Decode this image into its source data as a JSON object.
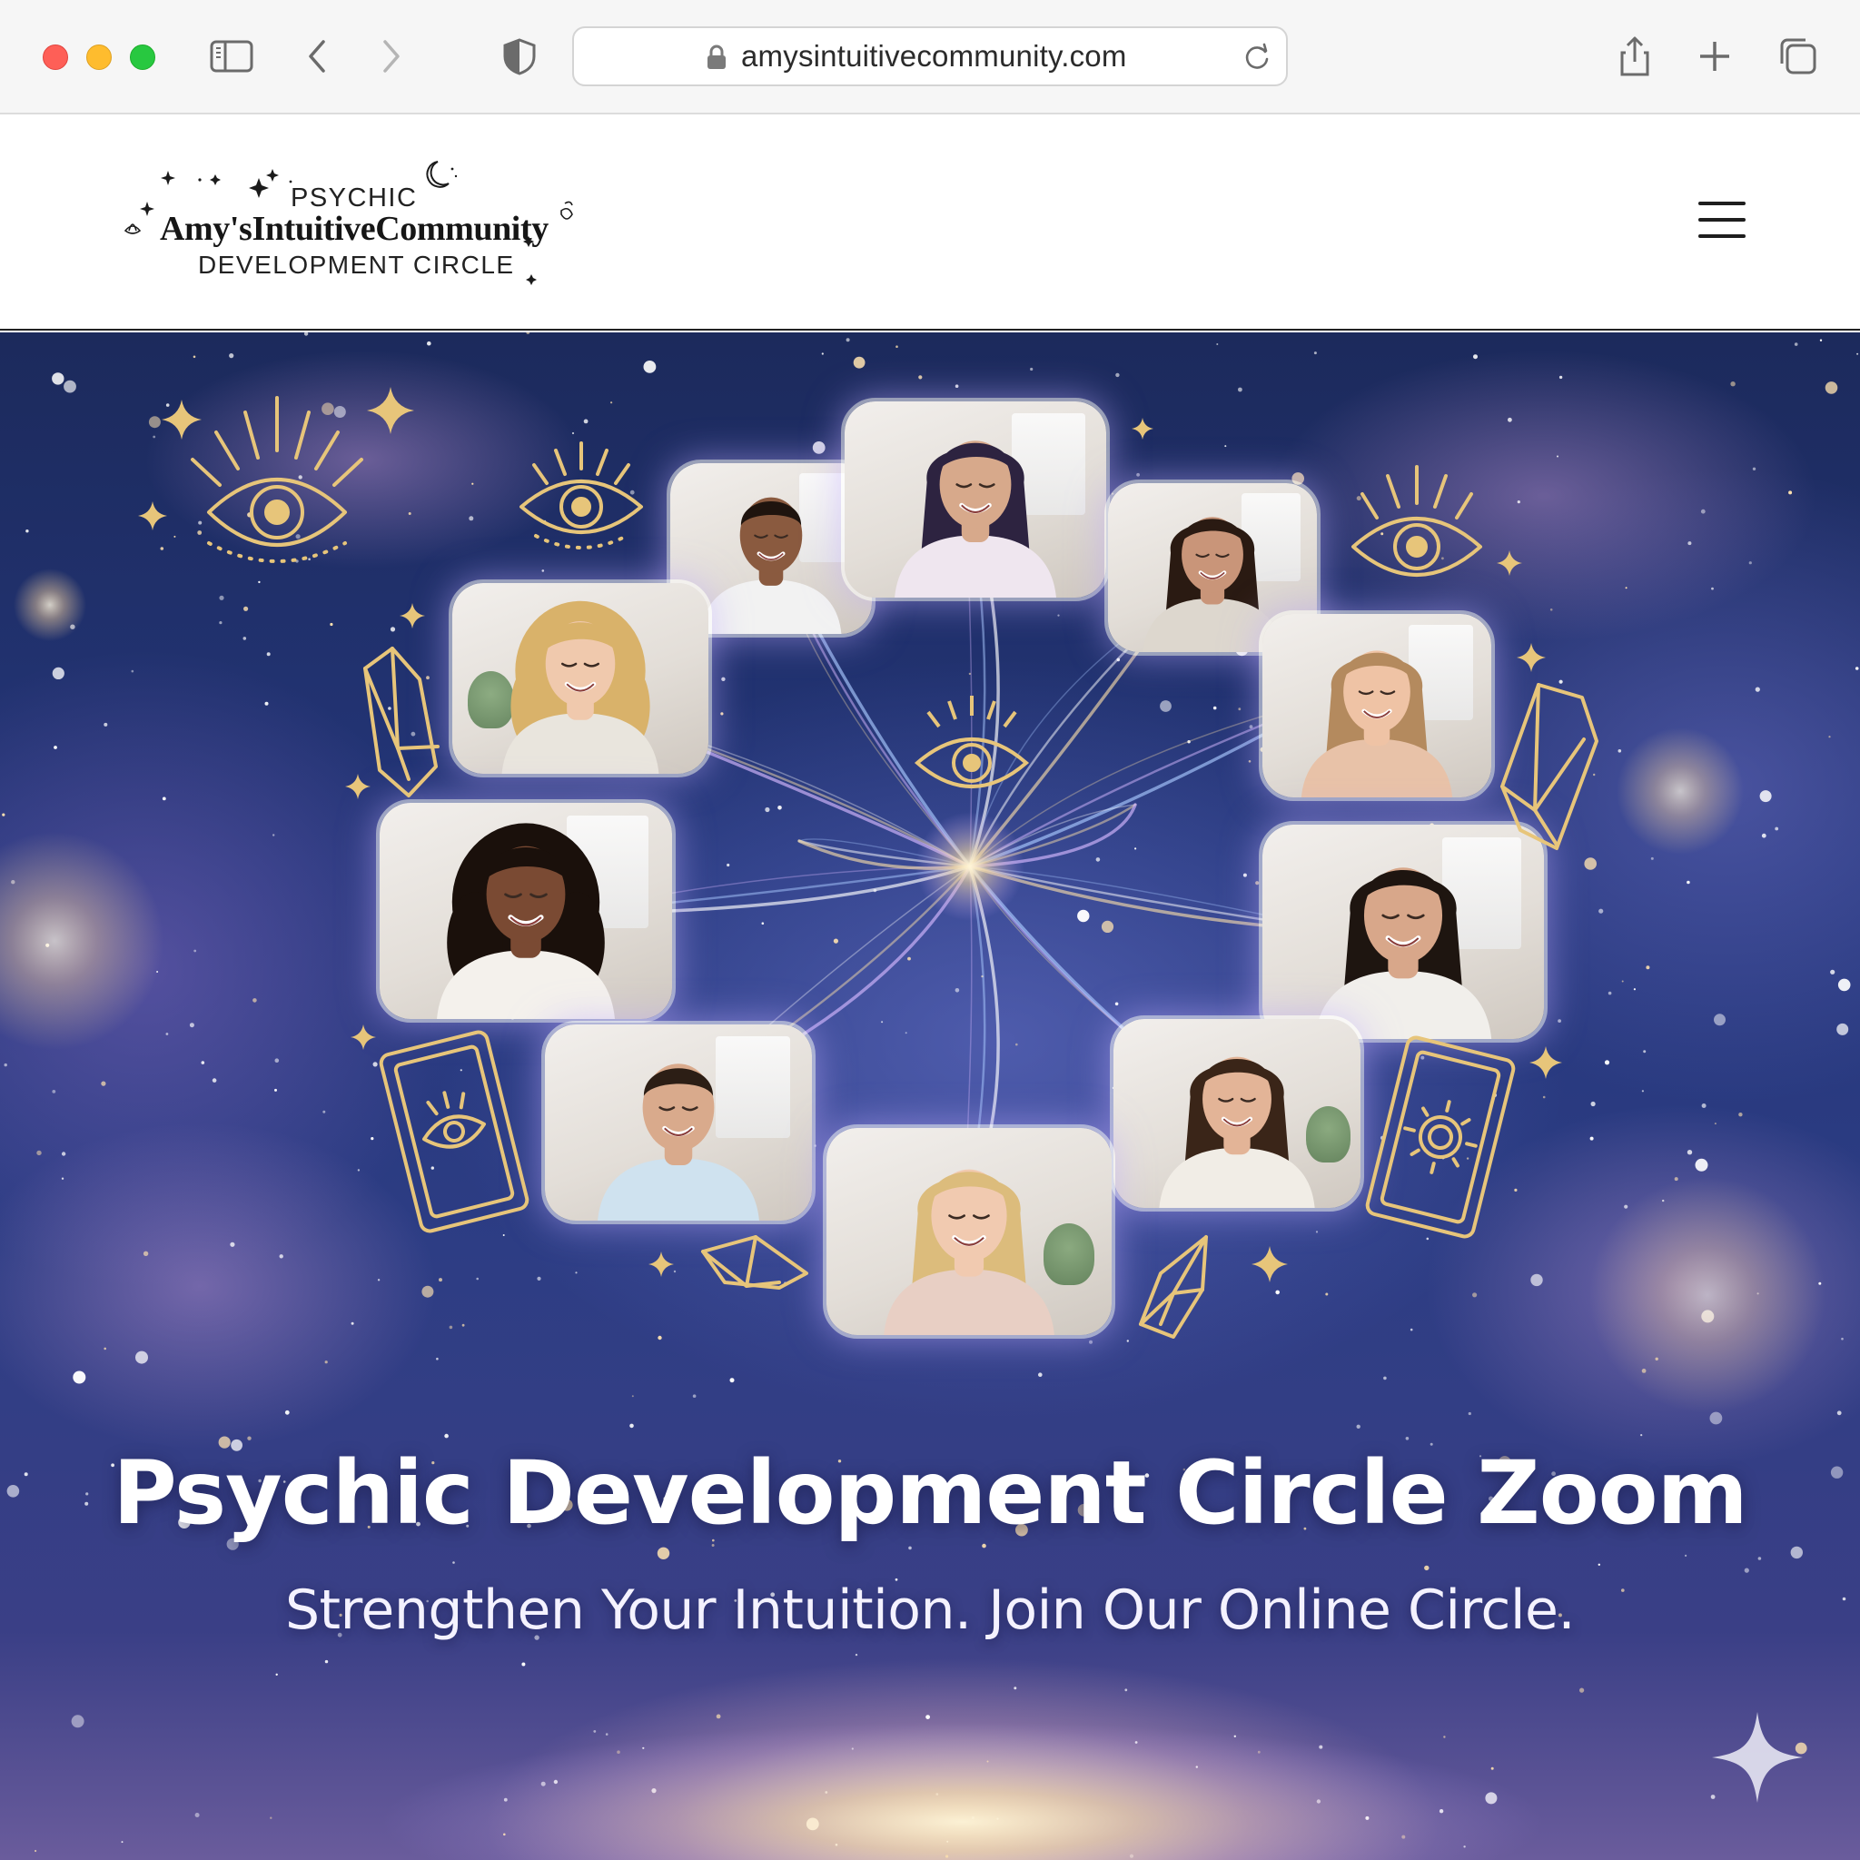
{
  "browser": {
    "url": "amysintuitivecommunity.com",
    "colors": {
      "close": "#fe5f57",
      "minimize": "#febc2e",
      "zoom": "#28c840"
    }
  },
  "site": {
    "logo": {
      "line1": "PSYCHIC",
      "line2": "Amy'sIntuitiveCommunity",
      "line3": "DEVELOPMENT CIRCLE"
    }
  },
  "hero": {
    "title": "Psychic Development Circle Zoom",
    "subtitle": "Strengthen Your Intuition. Join Our Online Circle.",
    "accent_gold": "#e7c57a",
    "participants": [
      {
        "skin": "#8a5a3f",
        "hair": "#1f140e",
        "shirt": "#f2f2f2",
        "hairstyle": "short"
      },
      {
        "skin": "#d7a98b",
        "hair": "#2d2340",
        "shirt": "#efe6ef",
        "hairstyle": "long"
      },
      {
        "skin": "#c99579",
        "hair": "#2a1a12",
        "shirt": "#ddd7ce",
        "hairstyle": "long"
      },
      {
        "skin": "#f0c9ad",
        "hair": "#d9b26a",
        "shirt": "#e9e5dd",
        "hairstyle": "curly"
      },
      {
        "skin": "#efc3a5",
        "hair": "#b48a5e",
        "shirt": "#e8c2a8",
        "hairstyle": "long"
      },
      {
        "skin": "#7a4a33",
        "hair": "#1a100b",
        "shirt": "#f4f1ec",
        "hairstyle": "curly"
      },
      {
        "skin": "#d8a78a",
        "hair": "#1e1510",
        "shirt": "#f1efeb",
        "hairstyle": "long"
      },
      {
        "skin": "#d9aa8c",
        "hair": "#2c1e15",
        "shirt": "#cfe2ef",
        "hairstyle": "short"
      },
      {
        "skin": "#e3b497",
        "hair": "#3a2518",
        "shirt": "#f1ede6",
        "hairstyle": "long"
      },
      {
        "skin": "#f1cab0",
        "hair": "#dcbc7c",
        "shirt": "#e8cfc4",
        "hairstyle": "long"
      }
    ]
  }
}
